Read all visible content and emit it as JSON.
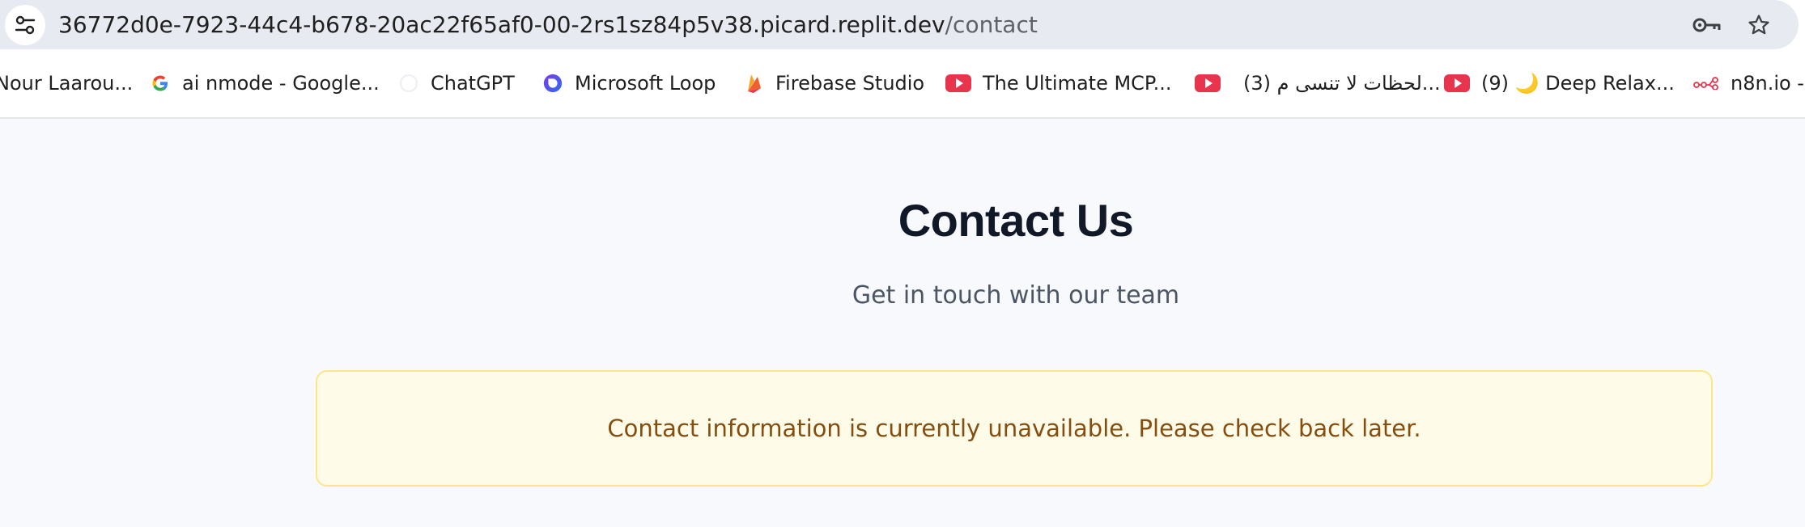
{
  "browser": {
    "url_host": "36772d0e-7923-44c4-b678-20ac22f65af0-00-2rs1sz84p5v38.picard.replit.dev",
    "url_path": "/contact",
    "site_info_icon": "tune-icon",
    "password_icon": "key-icon",
    "bookmark_icon": "star-icon"
  },
  "bookmarks": [
    {
      "label": "Nour Laarou...",
      "icon": "profile-icon"
    },
    {
      "label": "ai nmode - Google...",
      "icon": "google-icon"
    },
    {
      "label": "ChatGPT",
      "icon": "chatgpt-icon"
    },
    {
      "label": "Microsoft Loop",
      "icon": "loop-icon"
    },
    {
      "label": "Firebase Studio",
      "icon": "firebase-icon"
    },
    {
      "label": "The Ultimate MCP...",
      "icon": "youtube-icon"
    },
    {
      "label": "(3) لحظات لا تنسى م...",
      "icon": "youtube-icon"
    },
    {
      "label": "(9) 🌙 Deep Relax...",
      "icon": "youtube-icon"
    },
    {
      "label": "n8n.io -",
      "icon": "n8n-icon"
    }
  ],
  "page": {
    "title": "Contact Us",
    "subtitle": "Get in touch with our team",
    "notice": "Contact information is currently unavailable. Please check back later."
  },
  "colors": {
    "title": "#111827",
    "subtitle": "#4b5563",
    "notice_bg": "#fefce8",
    "notice_border": "#fde68a",
    "notice_text": "#854d0e",
    "youtube_red": "#e8344c"
  }
}
